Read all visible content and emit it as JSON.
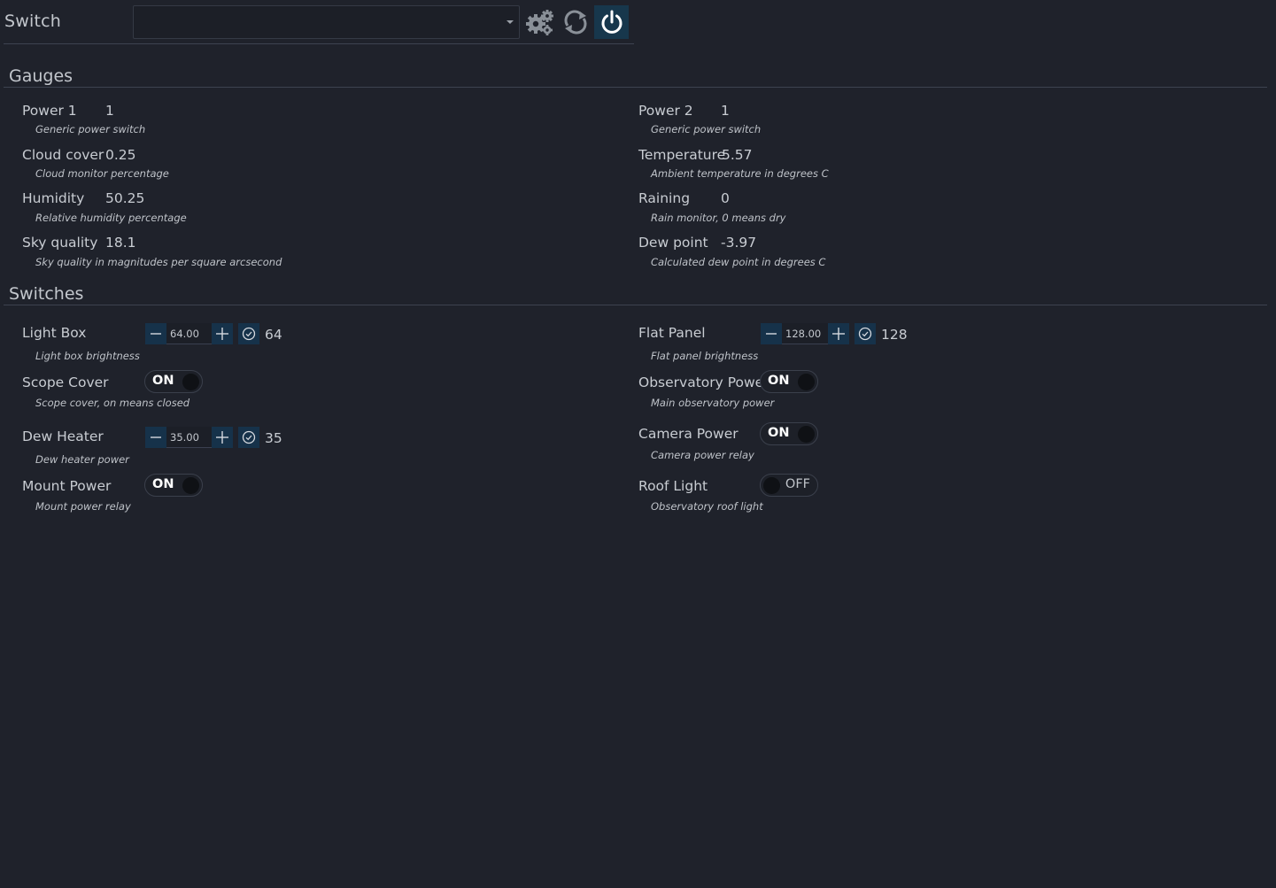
{
  "header": {
    "title": "Switch",
    "device_value": ""
  },
  "gauges": {
    "title": "Gauges",
    "left": [
      {
        "label": "Power 1",
        "value": "1",
        "desc": "Generic power switch"
      },
      {
        "label": "Cloud cover",
        "value": "0.25",
        "desc": "Cloud monitor percentage"
      },
      {
        "label": "Humidity",
        "value": "50.25",
        "desc": "Relative humidity percentage"
      },
      {
        "label": "Sky quality",
        "value": "18.1",
        "desc": "Sky quality in magnitudes per square arcsecond"
      }
    ],
    "right": [
      {
        "label": "Power 2",
        "value": "1",
        "desc": "Generic power switch"
      },
      {
        "label": "Temperature",
        "value": "5.57",
        "desc": "Ambient temperature in degrees C"
      },
      {
        "label": "Raining",
        "value": "0",
        "desc": "Rain monitor, 0 means dry"
      },
      {
        "label": "Dew point",
        "value": "-3.97",
        "desc": "Calculated dew point in degrees C"
      }
    ]
  },
  "switches": {
    "title": "Switches",
    "light_box": {
      "label": "Light Box",
      "input": "64.00",
      "value": "64",
      "desc": "Light box brightness"
    },
    "scope_cover": {
      "label": "Scope Cover",
      "state": "ON",
      "desc": "Scope cover, on means closed"
    },
    "dew_heater": {
      "label": "Dew Heater",
      "input": "35.00",
      "value": "35",
      "desc": "Dew heater power"
    },
    "mount_power": {
      "label": "Mount Power",
      "state": "ON",
      "desc": "Mount power relay"
    },
    "flat_panel": {
      "label": "Flat Panel",
      "input": "128.00",
      "value": "128",
      "desc": "Flat panel brightness"
    },
    "observatory_power": {
      "label": "Observatory Power",
      "state": "ON",
      "desc": "Main observatory power"
    },
    "camera_power": {
      "label": "Camera Power",
      "state": "ON",
      "desc": "Camera power relay"
    },
    "roof_light": {
      "label": "Roof Light",
      "state": "OFF",
      "desc": "Observatory roof light"
    }
  }
}
